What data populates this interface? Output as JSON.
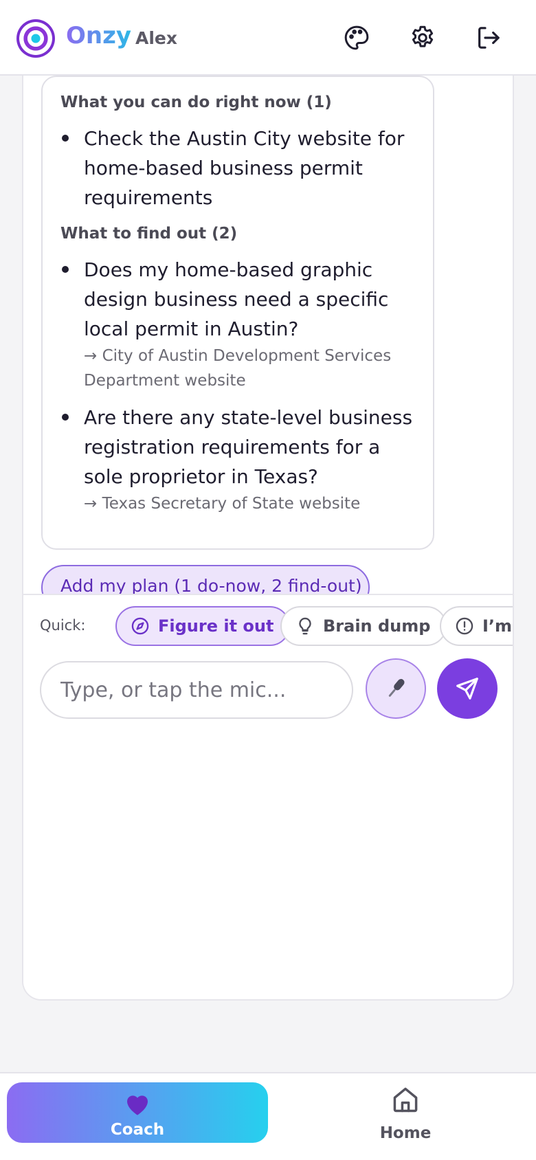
{
  "header": {
    "brand": "Onzy",
    "user_name": "Alex"
  },
  "plan": {
    "do_now_title": "What you can do right now (1)",
    "do_now": [
      {
        "text": "Check the Austin City website for home-based business permit requirements"
      }
    ],
    "find_out_title": "What to find out (2)",
    "find_out": [
      {
        "text": "Does my home-based graphic design business need a specific local permit in Austin?",
        "source": "→ City of Austin Development Services Department website"
      },
      {
        "text": "Are there any state-level business registration requirements for a sole proprietor in Texas?",
        "source": "→ Texas Secretary of State website"
      }
    ],
    "add_button": "Add my plan (1 do-now, 2 find-out)"
  },
  "composer": {
    "quick_label": "Quick:",
    "chips": [
      {
        "label": "Figure it out",
        "icon": "compass-icon",
        "active": true
      },
      {
        "label": "Brain dump",
        "icon": "lightbulb-icon",
        "active": false
      },
      {
        "label": "I’m stuck",
        "icon": "alert-circle-icon",
        "active": false
      }
    ],
    "placeholder": "Type, or tap the mic..."
  },
  "nav": {
    "coach": "Coach",
    "home": "Home"
  },
  "colors": {
    "accent": "#7b3ee0",
    "chip_active_bg": "#efe6fc",
    "brand_gradient_start": "#8b6cf2",
    "brand_gradient_end": "#26d0ee"
  }
}
